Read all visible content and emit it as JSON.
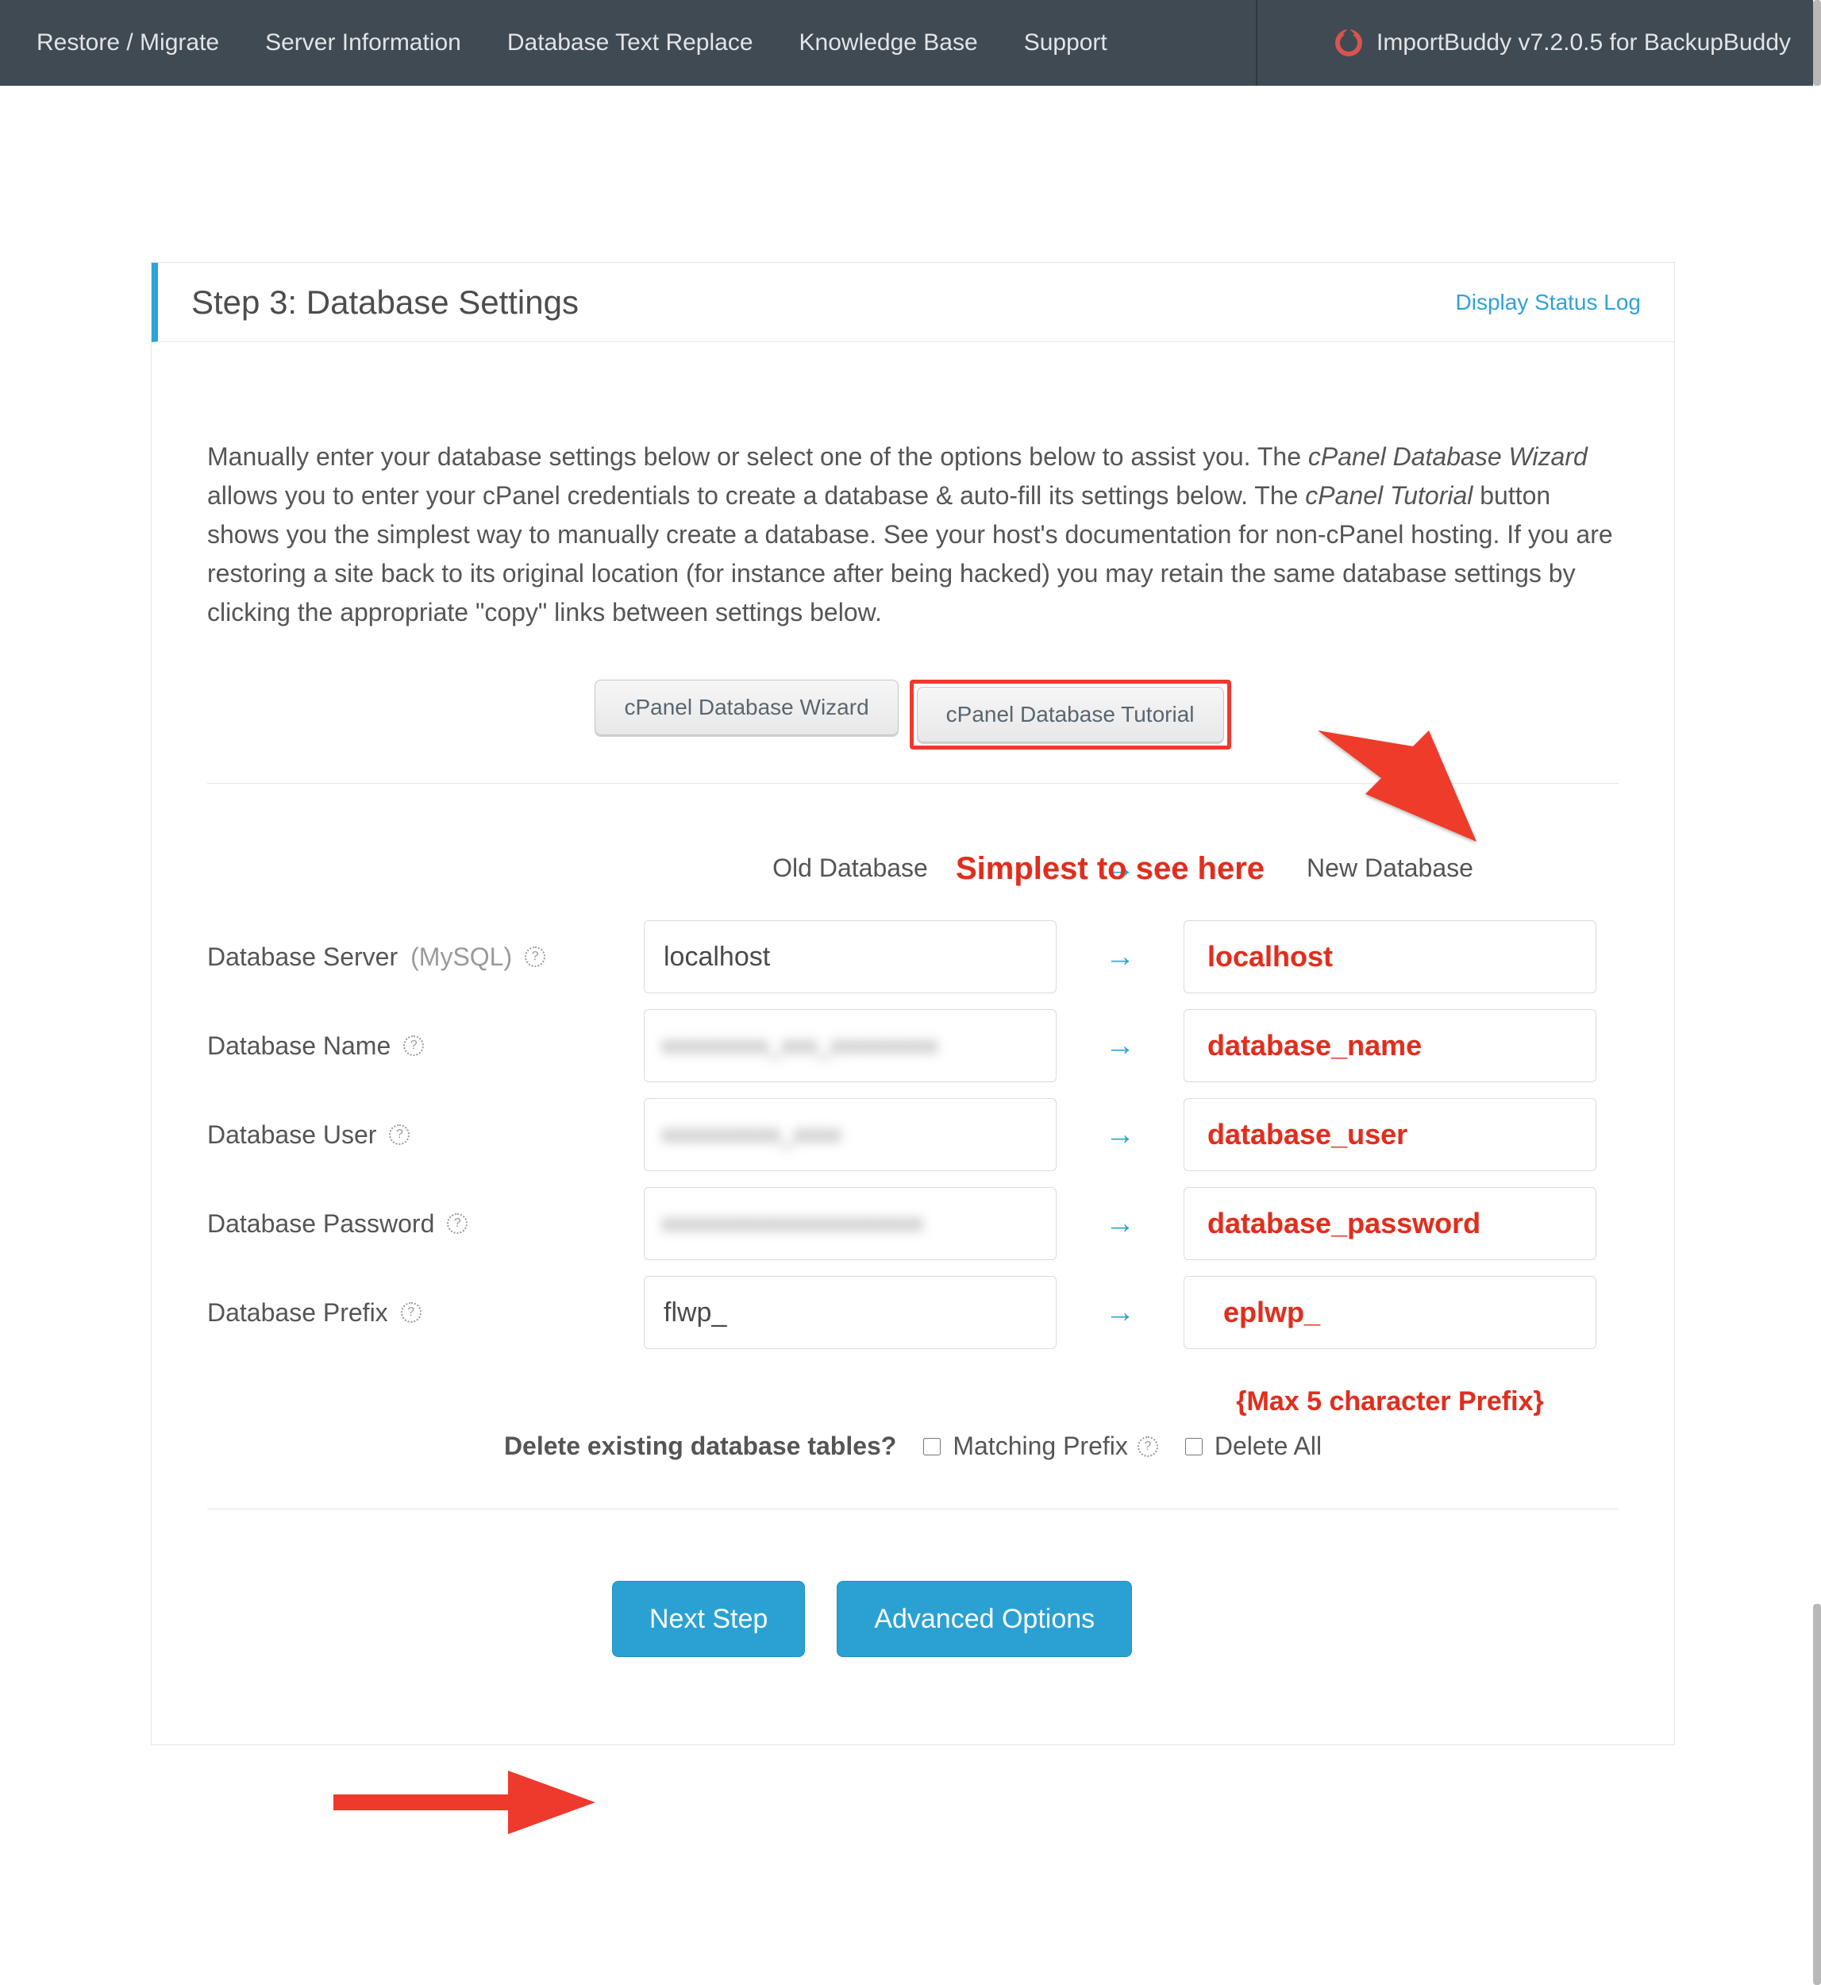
{
  "nav": {
    "items": [
      "Restore / Migrate",
      "Server Information",
      "Database Text Replace",
      "Knowledge Base",
      "Support"
    ],
    "brand": "ImportBuddy v7.2.0.5 for BackupBuddy"
  },
  "header": {
    "title": "Step 3: Database Settings",
    "status_log": "Display Status Log"
  },
  "intro": {
    "t1": "Manually enter your database settings below or select one of the options below to assist you. The ",
    "em1": "cPanel Database Wizard",
    "t2": " allows you to enter your cPanel credentials to create a database & auto-fill its settings below. The ",
    "em2": "cPanel Tutorial",
    "t3": " button shows you the simplest way to manually create a database. See your host's documentation for non-cPanel hosting. If you are restoring a site back to its original location (for instance after being hacked) you may retain the same database settings by clicking the appropriate \"copy\" links between settings below."
  },
  "buttons": {
    "cpanel_wizard": "cPanel Database Wizard",
    "cpanel_tutorial": "cPanel Database Tutorial"
  },
  "headers": {
    "old": "Old Database",
    "new": "New Database",
    "arrow": "→"
  },
  "rows": {
    "server": {
      "label": "Database Server",
      "hint": "(MySQL)",
      "old": "localhost",
      "annot": "localhost"
    },
    "name": {
      "label": "Database Name",
      "old_blur": "xxxxxxxxx_xxx_xxxxxxxxx",
      "annot": "database_name"
    },
    "user": {
      "label": "Database User",
      "old_blur": "xxxxxxxxxx_xxxx",
      "annot": "database_user"
    },
    "pass": {
      "label": "Database Password",
      "old_blur": "xxxxxxxxxxxxxxxxxxxxxx",
      "annot": "database_password"
    },
    "prefix": {
      "label": "Database Prefix",
      "old": "flwp_",
      "annot": "eplwp_",
      "note": "{Max 5 character Prefix}"
    }
  },
  "delete": {
    "question": "Delete existing database tables?",
    "matching": "Matching Prefix",
    "all": "Delete All"
  },
  "footer": {
    "next": "Next Step",
    "advanced": "Advanced Options"
  },
  "callouts": {
    "simplest": "Simplest to see here"
  }
}
